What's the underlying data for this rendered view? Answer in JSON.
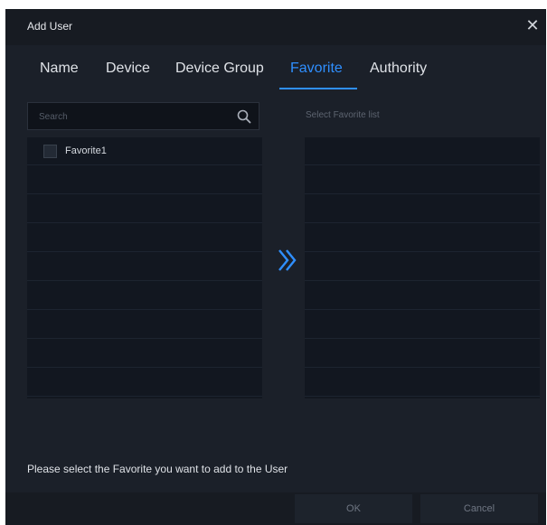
{
  "window": {
    "title": "Add User"
  },
  "tabs": [
    {
      "label": "Name"
    },
    {
      "label": "Device"
    },
    {
      "label": "Device Group"
    },
    {
      "label": "Favorite"
    },
    {
      "label": "Authority"
    }
  ],
  "active_tab": "Favorite",
  "search": {
    "placeholder": "Search",
    "value": ""
  },
  "right_panel": {
    "header": "Select Favorite list"
  },
  "favorites": [
    {
      "label": "Favorite1",
      "checked": false
    }
  ],
  "footer": {
    "message": "Please select the Favorite you want to add to the User",
    "ok_label": "OK",
    "cancel_label": "Cancel"
  },
  "icons": {
    "close": "close-icon",
    "search": "search-icon",
    "add": "double-chevron-right-icon"
  },
  "colors": {
    "accent": "#2f8fff",
    "background": "#1b2029",
    "panel": "#121720"
  }
}
